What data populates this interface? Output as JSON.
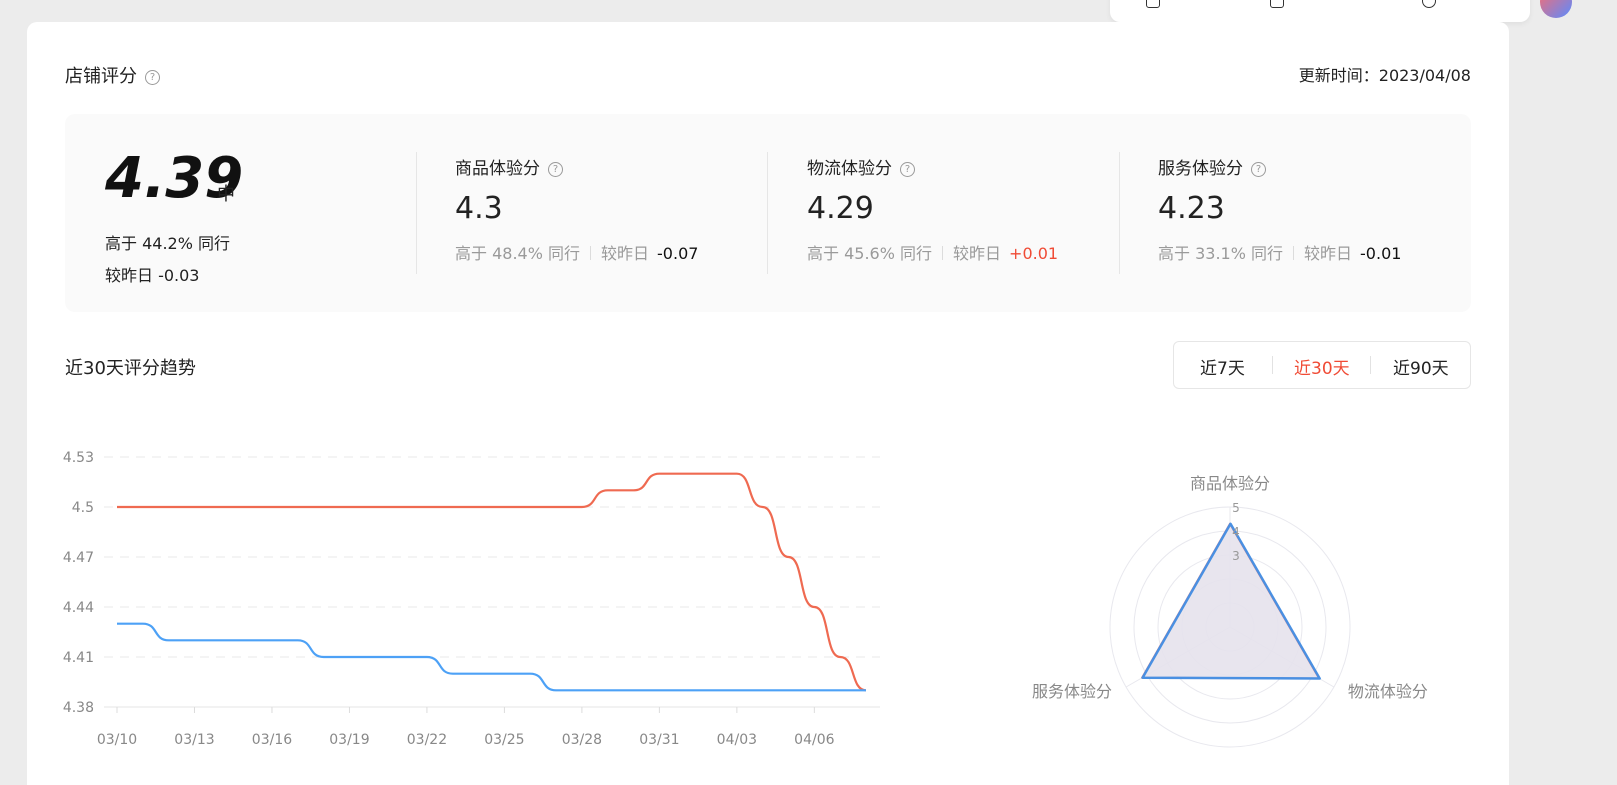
{
  "header": {
    "title": "店铺评分",
    "update_text": "更新时间：2023/04/08"
  },
  "overall": {
    "score": "4.39",
    "level": "中",
    "peer_text": "高于 44.2% 同行",
    "change_text": "较昨日 -0.03"
  },
  "metrics": [
    {
      "label": "商品体验分",
      "value": "4.3",
      "peer": "高于 48.4% 同行",
      "change_label": "较昨日",
      "change": "-0.07",
      "direction": "down"
    },
    {
      "label": "物流体验分",
      "value": "4.29",
      "peer": "高于 45.6% 同行",
      "change_label": "较昨日",
      "change": "+0.01",
      "direction": "up"
    },
    {
      "label": "服务体验分",
      "value": "4.23",
      "peer": "高于 33.1% 同行",
      "change_label": "较昨日",
      "change": "-0.01",
      "direction": "down"
    }
  ],
  "trend": {
    "title": "近30天评分趋势",
    "ranges": [
      "近7天",
      "近30天",
      "近90天"
    ],
    "active_range": "近30天"
  },
  "colors": {
    "accent": "#f04b35",
    "series_red": "#ef6a51",
    "series_blue": "#4da1f6",
    "radar_fill": "#e6e2ec"
  },
  "chart_data": [
    {
      "type": "line",
      "x": [
        "03/10",
        "03/11",
        "03/12",
        "03/13",
        "03/14",
        "03/15",
        "03/16",
        "03/17",
        "03/18",
        "03/19",
        "03/20",
        "03/21",
        "03/22",
        "03/23",
        "03/24",
        "03/25",
        "03/26",
        "03/27",
        "03/28",
        "03/29",
        "03/30",
        "03/31",
        "04/01",
        "04/02",
        "04/03",
        "04/04",
        "04/05",
        "04/06",
        "04/07",
        "04/08"
      ],
      "x_tick_labels": [
        "03/10",
        "03/13",
        "03/16",
        "03/19",
        "03/22",
        "03/25",
        "03/28",
        "03/31",
        "04/03",
        "04/06"
      ],
      "series": [
        {
          "color": "#ef6a51",
          "values": [
            4.5,
            4.5,
            4.5,
            4.5,
            4.5,
            4.5,
            4.5,
            4.5,
            4.5,
            4.5,
            4.5,
            4.5,
            4.5,
            4.5,
            4.5,
            4.5,
            4.5,
            4.5,
            4.5,
            4.51,
            4.51,
            4.52,
            4.52,
            4.52,
            4.52,
            4.5,
            4.47,
            4.44,
            4.41,
            4.39
          ]
        },
        {
          "color": "#4da1f6",
          "values": [
            4.43,
            4.43,
            4.42,
            4.42,
            4.42,
            4.42,
            4.42,
            4.42,
            4.41,
            4.41,
            4.41,
            4.41,
            4.41,
            4.4,
            4.4,
            4.4,
            4.4,
            4.39,
            4.39,
            4.39,
            4.39,
            4.39,
            4.39,
            4.39,
            4.39,
            4.39,
            4.39,
            4.39,
            4.39,
            4.39
          ]
        }
      ],
      "y_ticks": [
        4.38,
        4.41,
        4.44,
        4.47,
        4.5,
        4.53
      ],
      "y_tick_labels": [
        "4.38",
        "4.41",
        "4.44",
        "4.47",
        "4.5",
        "4.53"
      ],
      "ylim": [
        4.38,
        4.53
      ],
      "grid": true
    },
    {
      "type": "radar",
      "axes": [
        "商品体验分",
        "物流体验分",
        "服务体验分"
      ],
      "values": [
        4.3,
        4.29,
        4.23
      ],
      "ticks": [
        "5",
        "4",
        "3"
      ],
      "rmax": 5
    }
  ]
}
